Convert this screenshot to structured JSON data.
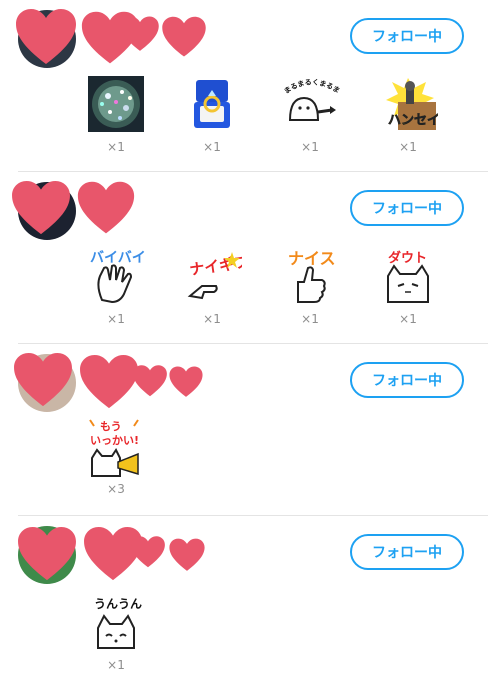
{
  "follow_label": "フォロー中",
  "users": [
    {
      "gifts": [
        {
          "icon": "glitter-ball-icon",
          "count": "×1"
        },
        {
          "icon": "ring-box-icon",
          "count": "×1"
        },
        {
          "icon": "cat-pointing-sticker",
          "text": "まるまるくまるまるし",
          "count": "×1"
        },
        {
          "icon": "hansei-sticker",
          "text": "ハンセイ",
          "count": "×1"
        }
      ]
    },
    {
      "gifts": [
        {
          "icon": "byebye-sticker",
          "text": "バイバイ",
          "count": "×1"
        },
        {
          "icon": "nice-gif-sticker",
          "text": "ナイギフ",
          "count": "×1"
        },
        {
          "icon": "nice-sticker",
          "text": "ナイス",
          "count": "×1"
        },
        {
          "icon": "doubt-cat-sticker",
          "text": "ダウト",
          "count": "×1"
        }
      ]
    },
    {
      "gifts": [
        {
          "icon": "mou-ikkai-sticker",
          "text_top": "もう",
          "text_bottom": "いっかい!",
          "count": "×3"
        }
      ]
    },
    {
      "gifts": [
        {
          "icon": "unun-cat-sticker",
          "text": "うんうん",
          "count": "×1"
        }
      ]
    }
  ],
  "colors": {
    "accent": "#1da1f2",
    "heart": "#e8566b"
  }
}
